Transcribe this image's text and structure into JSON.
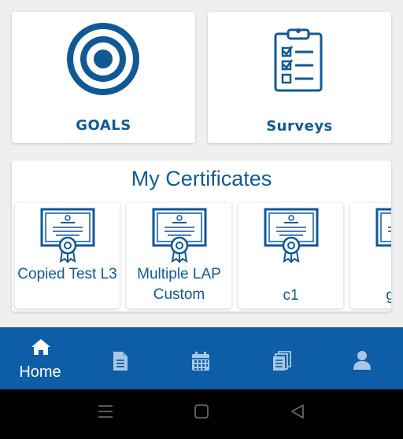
{
  "tiles": {
    "goals": {
      "label": "GOALS",
      "icon": "target-icon"
    },
    "surveys": {
      "label": "Surveys",
      "icon": "clipboard-checklist-icon"
    }
  },
  "certificates": {
    "title": "My Certificates",
    "items": [
      {
        "name": "Copied Test L3",
        "icon": "certificate-icon"
      },
      {
        "name": "Multiple LAP Custom",
        "icon": "certificate-icon"
      },
      {
        "name": "c1",
        "icon": "certificate-icon"
      },
      {
        "name": "gene",
        "icon": "certificate-icon"
      }
    ]
  },
  "bottom_nav": {
    "items": [
      {
        "label": "Home",
        "icon": "home-icon",
        "active": true
      },
      {
        "label": "",
        "icon": "document-icon"
      },
      {
        "label": "",
        "icon": "calendar-icon"
      },
      {
        "label": "",
        "icon": "documents-stack-icon"
      },
      {
        "label": "",
        "icon": "user-icon"
      }
    ]
  },
  "system_nav": {
    "icons": [
      "menu-icon",
      "home-square-icon",
      "back-triangle-icon"
    ]
  },
  "colors": {
    "brand_blue": "#0f5a96",
    "nav_bg": "#0d5ea6",
    "tile_bg": "#ffffff",
    "page_bg": "#efefef"
  }
}
